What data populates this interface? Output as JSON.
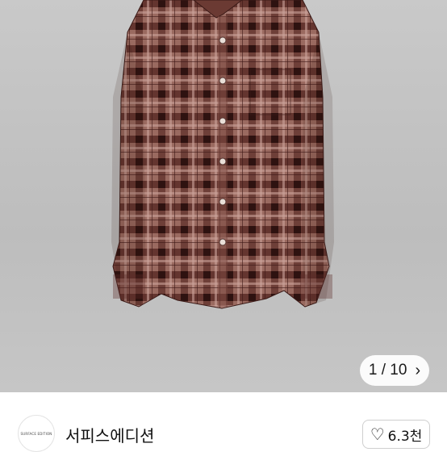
{
  "product_image": {
    "description_icon": "plaid-shirt-image",
    "colors": {
      "base": "#8a5a52",
      "dark": "#4a2320",
      "light": "#b58a80",
      "background": "#c4c4c4"
    }
  },
  "gallery": {
    "current": "1",
    "separator": "/",
    "total": "10",
    "counter_text": "1 / 10",
    "next_icon": "chevron-right-icon"
  },
  "seller": {
    "name": "서피스에디션",
    "avatar_logo": "SURFACE EDITION"
  },
  "like": {
    "icon": "heart-outline-icon",
    "count": "6.3천"
  }
}
